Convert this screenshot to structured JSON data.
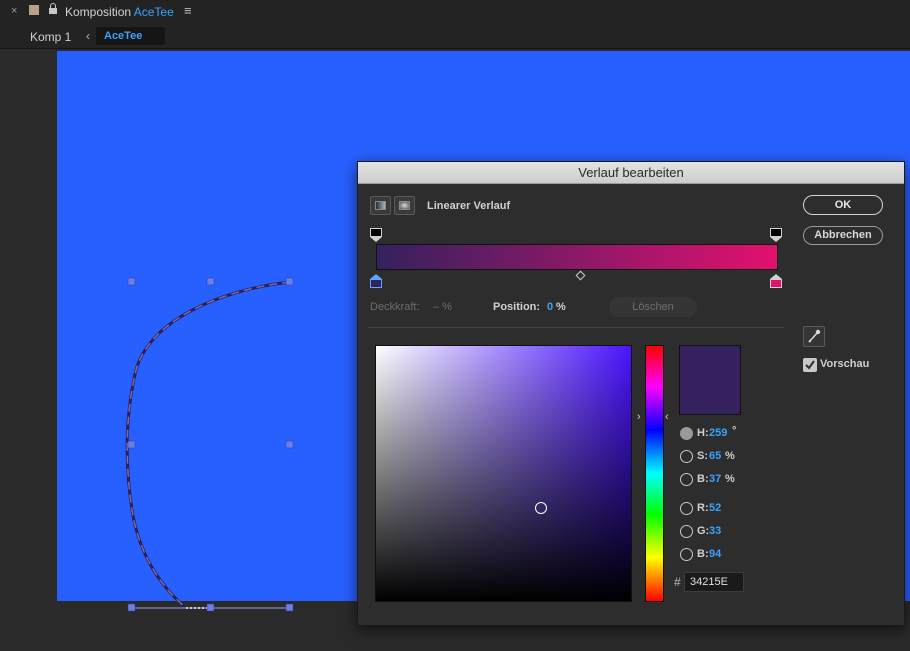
{
  "header": {
    "close_glyph": "×",
    "title_prefix": "Komposition",
    "title_comp": "AceTee",
    "menu_glyph": "≡"
  },
  "breadcrumb": {
    "parent": "Komp 1",
    "separator": "‹",
    "current": "AceTee"
  },
  "canvas": {
    "background_color": "#2860ff"
  },
  "dialog": {
    "title": "Verlauf bearbeiten",
    "gradient_type_label": "Linearer Verlauf",
    "ok_label": "OK",
    "cancel_label": "Abbrechen",
    "gradient_start_color": "#34215E",
    "gradient_end_color": "#e3106f",
    "opacity_label": "Deckkraft:",
    "opacity_value": "– %",
    "position_label": "Position:",
    "position_value": "0",
    "position_unit": "%",
    "delete_label": "Löschen",
    "preview_label": "Vorschau",
    "preview_checked": true,
    "picker": {
      "hue_arrow_left": "›",
      "hue_arrow_right": "‹",
      "h_label": "H:",
      "h_value": "259",
      "h_unit": "°",
      "s_label": "S:",
      "s_value": "65",
      "s_unit": "%",
      "b_label": "B:",
      "b_value": "37",
      "b_unit": "%",
      "r_label": "R:",
      "r_value": "52",
      "g_label": "G:",
      "g_value": "33",
      "bl_label": "B:",
      "bl_value": "94",
      "hash": "#",
      "hex_value": "34215E",
      "selected_color": "#34215E"
    }
  }
}
